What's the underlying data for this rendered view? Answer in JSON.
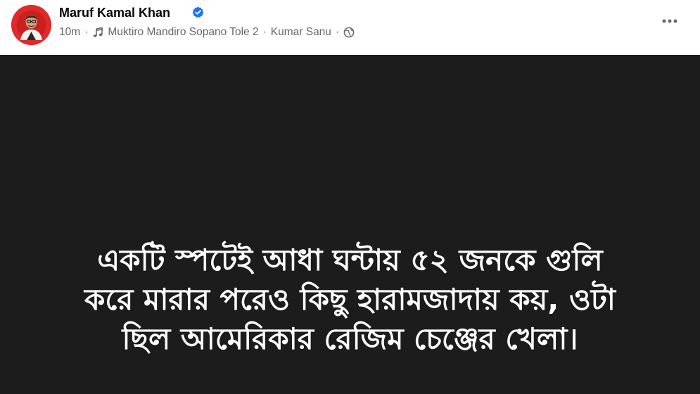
{
  "author": {
    "name": "Maruf Kamal Khan",
    "verified": true,
    "avatar_color": "#e02a2a"
  },
  "meta": {
    "time": "10m",
    "music_icon": "music-note-icon",
    "song": "Muktiro Mandiro Sopano Tole 2",
    "artist": "Kumar Sanu",
    "privacy_icon": "globe-icon",
    "separator": "·"
  },
  "header": {
    "more_icon": "more-horizontal-icon"
  },
  "post": {
    "background": "#1c1c1c",
    "text_color": "#ffffff",
    "lines": [
      "একটি স্পটেই আধা ঘন্টায় ৫২ জনকে গুলি",
      "করে মারার পরেও কিছু হারামজাদায় কয়, ওটা",
      "ছিল আমেরিকার রেজিম চেঞ্জের খেলা।"
    ]
  },
  "colors": {
    "verified_badge": "#1877f2",
    "meta_text": "#65676b",
    "name_text": "#050505"
  }
}
